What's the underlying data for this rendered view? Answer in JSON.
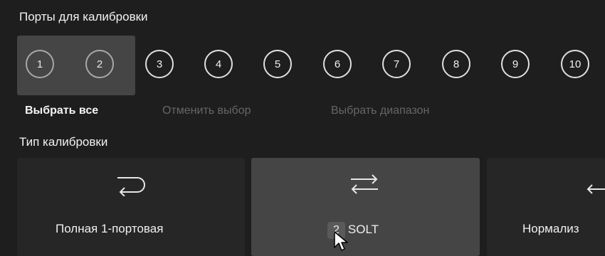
{
  "ports_section": {
    "title": "Порты для калибровки",
    "ports": [
      {
        "label": "1",
        "selected": true
      },
      {
        "label": "2",
        "selected": true
      },
      {
        "label": "3",
        "selected": false
      },
      {
        "label": "4",
        "selected": false
      },
      {
        "label": "5",
        "selected": false
      },
      {
        "label": "6",
        "selected": false
      },
      {
        "label": "7",
        "selected": false
      },
      {
        "label": "8",
        "selected": false
      },
      {
        "label": "9",
        "selected": false
      },
      {
        "label": "10",
        "selected": false
      }
    ],
    "actions": {
      "select_all": "Выбрать все",
      "cancel_selection": "Отменить выбор",
      "select_range": "Выбрать диапазон"
    }
  },
  "calibration_section": {
    "title": "Тип калибровки",
    "types": [
      {
        "label": "Полная 1-портовая",
        "icon": "one-port-loop-icon",
        "selected": false
      },
      {
        "badge": "2",
        "label": "SOLT",
        "icon": "two-port-arrows-icon",
        "selected": true
      },
      {
        "label": "Нормализ",
        "icon": "normalization-arrow-icon",
        "selected": false
      }
    ]
  },
  "colors": {
    "background": "#1e1e1e",
    "selected_bg": "#454545",
    "disabled_text": "#666666"
  }
}
